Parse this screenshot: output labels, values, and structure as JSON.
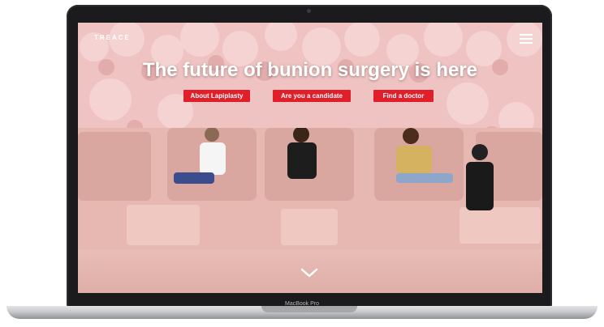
{
  "site": {
    "logo": "TREACE",
    "menu_icon": "hamburger-menu-icon"
  },
  "hero": {
    "headline": "The future of bunion surgery is here",
    "buttons": [
      {
        "label": "About Lapiplasty"
      },
      {
        "label": "Are you a candidate"
      },
      {
        "label": "Find a doctor"
      }
    ],
    "scroll_icon": "chevron-down-icon"
  },
  "device": {
    "label": "MacBook Pro"
  },
  "colors": {
    "accent": "#e01f2b",
    "text_on_hero": "#ffffff",
    "laptop_frame": "#1b1b1d"
  }
}
